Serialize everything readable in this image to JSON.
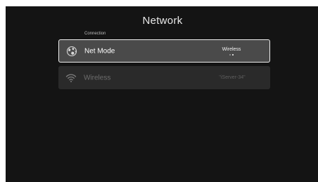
{
  "page": {
    "title": "Network",
    "section_label": "Connection"
  },
  "rows": [
    {
      "label": "Net Mode",
      "value": "Wireless",
      "icon": "globe-icon",
      "focused": true,
      "option_dots": 2,
      "active_dot": 2
    },
    {
      "label": "Wireless",
      "value": "\"iServer-34\"",
      "icon": "wifi-icon",
      "focused": false
    }
  ],
  "colors": {
    "background": "#141414",
    "focused_row": "#4a4a4a",
    "row": "#2a2a2a",
    "focus_border": "#ececec",
    "dim_text": "#6e6e6e"
  }
}
